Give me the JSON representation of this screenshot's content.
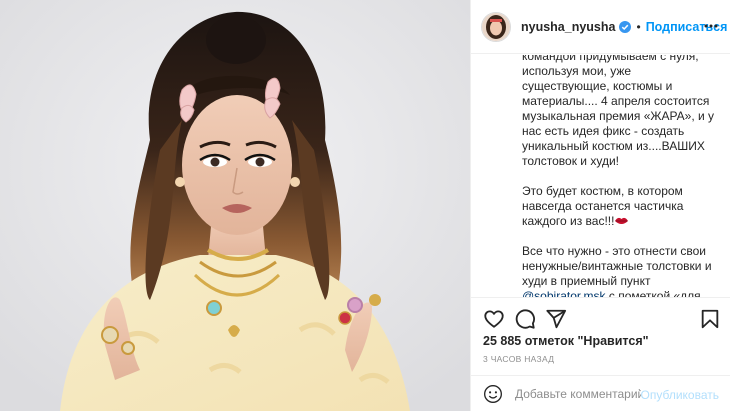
{
  "post": {
    "image_alt": "",
    "author": {
      "username": "nyusha_nyusha",
      "verified": true
    },
    "separator": "•",
    "follow_label": "Подписаться",
    "more_icon": "more-horizontal-icon",
    "caption": {
      "p1": "командой придумываем с нуля, используя мои, уже существующие, костюмы и материалы.... 4 апреля состоится музыкальная премия «ЖАРА», и у нас есть идея фикс - создать уникальный костюм из....ВАШИХ толстовок и худи!",
      "p2": "Это будет костюм, в котором навсегда останется частичка каждого из вас!!!",
      "p3_before": "Все что нужно - это отнести свои ненужные/винтажные толстовки и худи в приемный пункт ",
      "mention": "@sobirator.msk",
      "p3_after": " с пометкой «для Нюши» по адресу:"
    },
    "actions": [
      "heart-icon",
      "comment-icon",
      "share-icon",
      "bookmark-icon"
    ],
    "likes_text": "25 885 отметок \"Нравится\"",
    "time_ago": "3 часов назад",
    "comment": {
      "placeholder": "Добавьте комментарий...",
      "publish_label": "Опубликовать"
    },
    "colors": {
      "accent": "#0095f6",
      "publish_disabled": "#b2dffc",
      "text": "#262626",
      "muted": "#8e8e8e",
      "border": "#efefef"
    }
  }
}
